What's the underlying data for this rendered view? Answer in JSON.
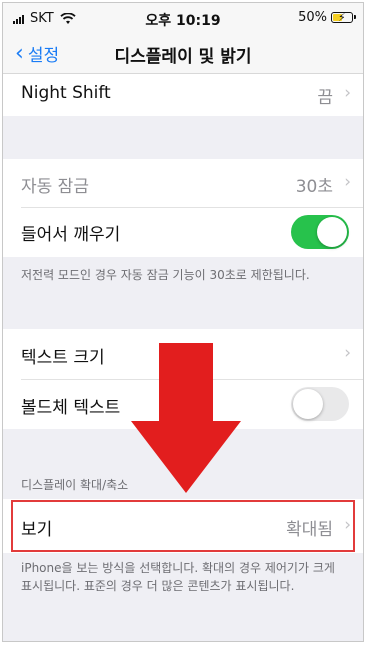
{
  "status_bar": {
    "carrier": "SKT",
    "time": "오후 10:19",
    "battery": "50%"
  },
  "nav": {
    "back_label": "설정",
    "title": "디스플레이 및 밝기"
  },
  "rows": {
    "night_shift": {
      "label": "Night Shift",
      "value": "끔"
    },
    "auto_lock": {
      "label": "자동 잠금",
      "value": "30초"
    },
    "raise_to_wake": {
      "label": "들어서 깨우기",
      "on": true
    },
    "low_power_note": "저전력 모드인 경우 자동 잠금 기능이 30초로 제한됩니다.",
    "text_size": {
      "label": "텍스트 크기"
    },
    "bold_text": {
      "label": "볼드체 텍스트",
      "on": false
    },
    "zoom_header": "디스플레이 확대/축소",
    "view": {
      "label": "보기",
      "value": "확대됨"
    },
    "view_note": "iPhone을 보는 방식을 선택합니다. 확대의 경우 제어기가 크게 표시됩니다. 표준의 경우 더 많은 콘텐츠가 표시됩니다."
  },
  "colors": {
    "accent": "#1a7cf5",
    "toggle_on": "#27c24c",
    "annotation_red": "#e21e1e"
  }
}
